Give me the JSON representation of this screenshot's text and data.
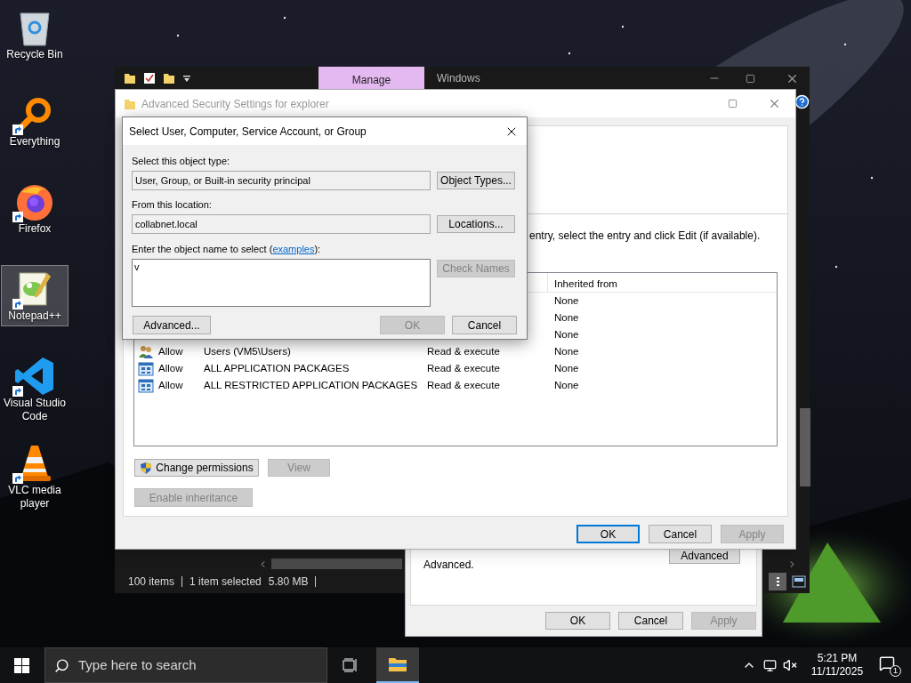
{
  "desktop_icons": [
    {
      "label": "Recycle Bin",
      "kind": "recycle",
      "shortcut": false,
      "selected": false
    },
    {
      "label": "Everything",
      "kind": "magnifier",
      "shortcut": true,
      "selected": false
    },
    {
      "label": "Firefox",
      "kind": "browser",
      "shortcut": true,
      "selected": false
    },
    {
      "label": "Notepad++",
      "kind": "notepad",
      "shortcut": true,
      "selected": true
    },
    {
      "label": "Visual Studio Code",
      "kind": "code",
      "shortcut": true,
      "selected": false
    },
    {
      "label": "VLC media player",
      "kind": "cone",
      "shortcut": true,
      "selected": false
    }
  ],
  "explorer": {
    "ribbon_tabs": [
      {
        "label": "Manage",
        "contextual": true
      },
      {
        "label": "Windows",
        "contextual": false
      }
    ],
    "status": [
      {
        "text": "100 items",
        "separator": true
      },
      {
        "text": "1 item selected",
        "separator": false
      },
      {
        "text": "5.80 MB",
        "separator": true
      }
    ]
  },
  "properties_window": {
    "note": "Advanced.",
    "advanced_button": "Advanced",
    "buttons": [
      {
        "label": "OK",
        "disabled": false
      },
      {
        "label": "Cancel",
        "disabled": false
      },
      {
        "label": "Apply",
        "disabled": true
      }
    ]
  },
  "advanced_security": {
    "title": "Advanced Security Settings for explorer",
    "instruction": "entry, select the entry and click Edit (if available).",
    "columns": [
      "Inherited from"
    ],
    "rows": [
      {
        "inherited_from": "None"
      },
      {
        "inherited_from": "None"
      },
      {
        "inherited_from": "None"
      },
      {
        "kind": "users",
        "type": "Allow",
        "principal": "Users (VM5\\Users)",
        "access": "Read & execute",
        "inherited_from": "None"
      },
      {
        "kind": "package",
        "type": "Allow",
        "principal": "ALL APPLICATION PACKAGES",
        "access": "Read & execute",
        "inherited_from": "None"
      },
      {
        "kind": "package",
        "type": "Allow",
        "principal": "ALL RESTRICTED APPLICATION PACKAGES",
        "access": "Read & execute",
        "inherited_from": "None"
      }
    ],
    "action_buttons": [
      {
        "label": "Change permissions",
        "disabled": false,
        "shield": true
      },
      {
        "label": "View",
        "disabled": true,
        "shield": false
      }
    ],
    "inheritance_button": {
      "label": "Enable inheritance",
      "disabled": true
    },
    "buttons": [
      {
        "label": "OK",
        "disabled": false,
        "default": true
      },
      {
        "label": "Cancel",
        "disabled": false,
        "default": false
      },
      {
        "label": "Apply",
        "disabled": true,
        "default": false
      }
    ]
  },
  "select_dialog": {
    "title": "Select User, Computer, Service Account, or Group",
    "object_type_label": "Select this object type:",
    "object_type": "User, Group, or Built-in security principal",
    "object_types_button": "Object Types...",
    "location_label": "From this location:",
    "location": "collabnet.local",
    "locations_button": "Locations...",
    "name_label_start": "Enter the object name to select (",
    "examples_link": "examples",
    "name_label_end": "):",
    "name_value": "v",
    "check_names": {
      "label": "Check Names",
      "disabled": true
    },
    "advanced_button": "Advanced...",
    "ok": {
      "label": "OK",
      "disabled": true
    },
    "cancel": {
      "label": "Cancel",
      "disabled": false
    }
  },
  "taskbar": {
    "search_placeholder": "Type here to search",
    "time": "5:21 PM",
    "date": "11/11/2025",
    "notification_count": "1"
  }
}
